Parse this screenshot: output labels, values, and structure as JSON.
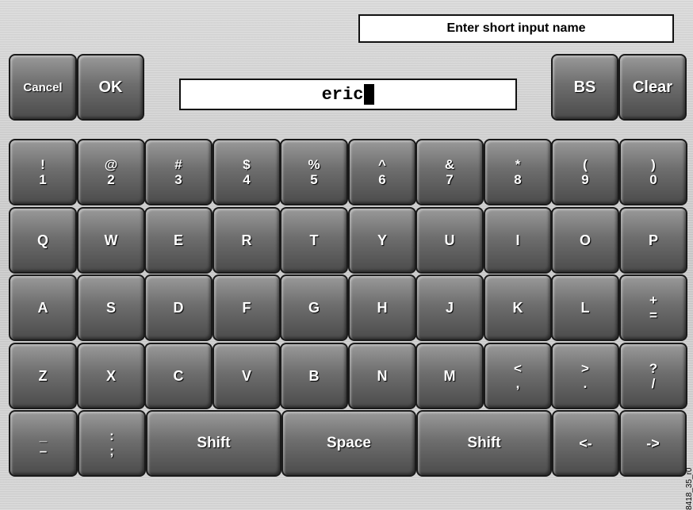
{
  "prompt": "Enter short input name",
  "input": {
    "value": "eric"
  },
  "buttons": {
    "cancel": "Cancel",
    "ok": "OK",
    "bs": "BS",
    "clear": "Clear"
  },
  "rows": [
    [
      {
        "top": "!",
        "bot": "1"
      },
      {
        "top": "@",
        "bot": "2"
      },
      {
        "top": "#",
        "bot": "3"
      },
      {
        "top": "$",
        "bot": "4"
      },
      {
        "top": "%",
        "bot": "5"
      },
      {
        "top": "^",
        "bot": "6"
      },
      {
        "top": "&",
        "bot": "7"
      },
      {
        "top": "*",
        "bot": "8"
      },
      {
        "top": "(",
        "bot": "9"
      },
      {
        "top": ")",
        "bot": "0"
      }
    ],
    [
      {
        "label": "Q"
      },
      {
        "label": "W"
      },
      {
        "label": "E"
      },
      {
        "label": "R"
      },
      {
        "label": "T"
      },
      {
        "label": "Y"
      },
      {
        "label": "U"
      },
      {
        "label": "I"
      },
      {
        "label": "O"
      },
      {
        "label": "P"
      }
    ],
    [
      {
        "label": "A"
      },
      {
        "label": "S"
      },
      {
        "label": "D"
      },
      {
        "label": "F"
      },
      {
        "label": "G"
      },
      {
        "label": "H"
      },
      {
        "label": "J"
      },
      {
        "label": "K"
      },
      {
        "label": "L"
      },
      {
        "top": "+",
        "bot": "="
      }
    ],
    [
      {
        "label": "Z"
      },
      {
        "label": "X"
      },
      {
        "label": "C"
      },
      {
        "label": "V"
      },
      {
        "label": "B"
      },
      {
        "label": "N"
      },
      {
        "label": "M"
      },
      {
        "top": "<",
        "bot": ","
      },
      {
        "top": ">",
        "bot": "."
      },
      {
        "top": "?",
        "bot": "/"
      }
    ]
  ],
  "bottom_row": {
    "underscore": {
      "top": "_",
      "bot": "–"
    },
    "colon": {
      "top": ":",
      "bot": ";"
    },
    "shift_left": "Shift",
    "space": "Space",
    "shift_right": "Shift",
    "left_arrow": "<-",
    "right_arrow": "->"
  },
  "side_id": "8418_35_r0"
}
